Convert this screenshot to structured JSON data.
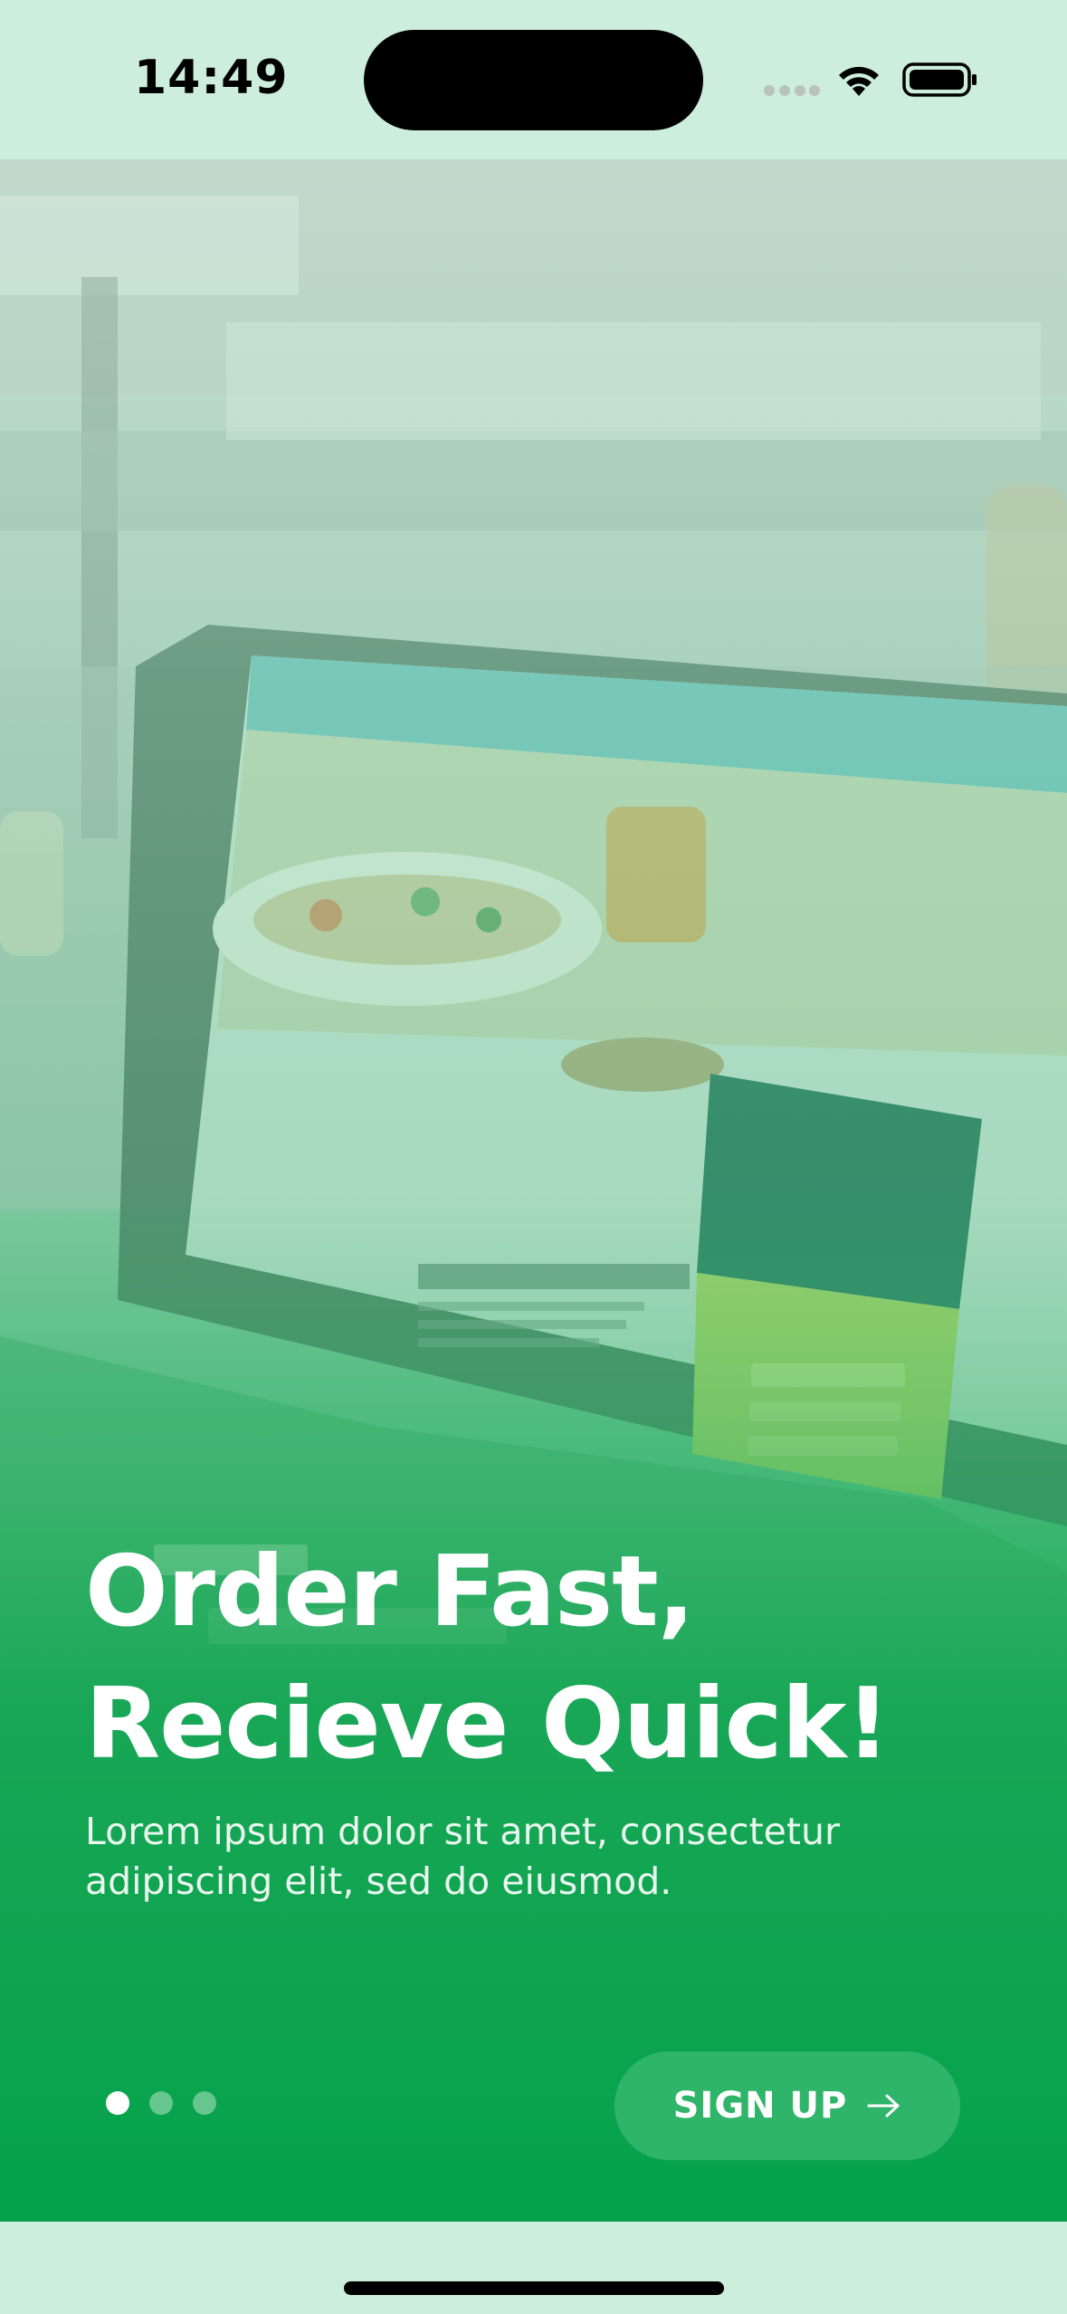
{
  "status_bar": {
    "time": "14:49",
    "signal_icon": "cellular-signal-icon",
    "wifi_icon": "wifi-icon",
    "battery_icon": "battery-icon"
  },
  "hero": {
    "background_image": "laptop-on-table-photo",
    "title_line1": "Order Fast,",
    "title_line2": "Recieve Quick!",
    "subtitle_line1": "Lorem ipsum dolor sit amet, consectetur",
    "subtitle_line2": "adipiscing elit, sed do eiusmod."
  },
  "pager": {
    "total": 3,
    "active_index": 0
  },
  "signup_button": {
    "label": "SIGN UP",
    "icon": "arrow-right-icon"
  },
  "colors": {
    "background": "#cdeedc",
    "brand_green": "#07a24c",
    "button_green": "#2fb569",
    "text_white": "#ffffff"
  }
}
